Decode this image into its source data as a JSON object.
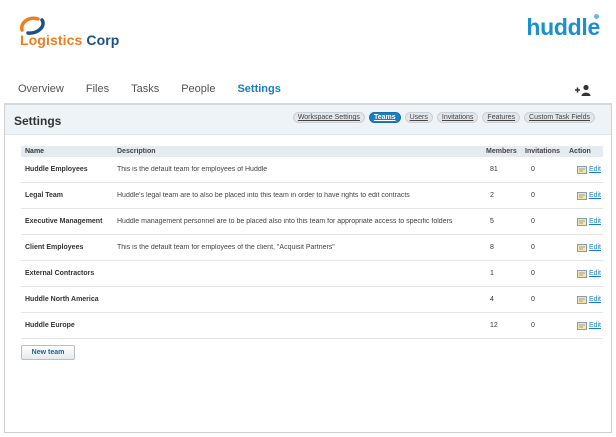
{
  "company": {
    "name_part1": "Logistics",
    "name_part2": "Corp"
  },
  "brand": {
    "name": "huddle"
  },
  "nav": {
    "tabs": [
      {
        "label": "Overview"
      },
      {
        "label": "Files"
      },
      {
        "label": "Tasks"
      },
      {
        "label": "People"
      },
      {
        "label": "Settings",
        "active": true
      }
    ]
  },
  "panel": {
    "title": "Settings",
    "subtabs": [
      {
        "label": "Workspace Settings"
      },
      {
        "label": "Teams",
        "active": true
      },
      {
        "label": "Users"
      },
      {
        "label": "Invitations"
      },
      {
        "label": "Features"
      },
      {
        "label": "Custom Task Fields"
      }
    ]
  },
  "table": {
    "headers": {
      "name": "Name",
      "description": "Description",
      "members": "Members",
      "invitations": "Invitations",
      "action": "Action"
    },
    "edit_label": "Edit",
    "rows": [
      {
        "name": "Huddle Employees",
        "description": "This is the default team for employees of Huddle",
        "members": "81",
        "invitations": "0"
      },
      {
        "name": "Legal Team",
        "description": "Huddle's legal team are to also be placed into this team in order to have rights to edit contracts",
        "members": "2",
        "invitations": "0"
      },
      {
        "name": "Executive Management",
        "description": "Huddle management personnel are to be placed also into this team for appropriate access to specific folders",
        "members": "5",
        "invitations": "0"
      },
      {
        "name": "Client Employees",
        "description": "This is the default team for employees of the client, \"Acquisit Partners\"",
        "members": "8",
        "invitations": "0"
      },
      {
        "name": "External Contractors",
        "description": "",
        "members": "1",
        "invitations": "0"
      },
      {
        "name": "Huddle North America",
        "description": "",
        "members": "4",
        "invitations": "0"
      },
      {
        "name": "Huddle Europe",
        "description": "",
        "members": "12",
        "invitations": "0"
      }
    ]
  },
  "actions": {
    "new_team_label": "New team"
  },
  "colors": {
    "accent": "#1a7ec2",
    "logo_orange": "#f07d1a",
    "logo_blue": "#1d4f8a"
  }
}
